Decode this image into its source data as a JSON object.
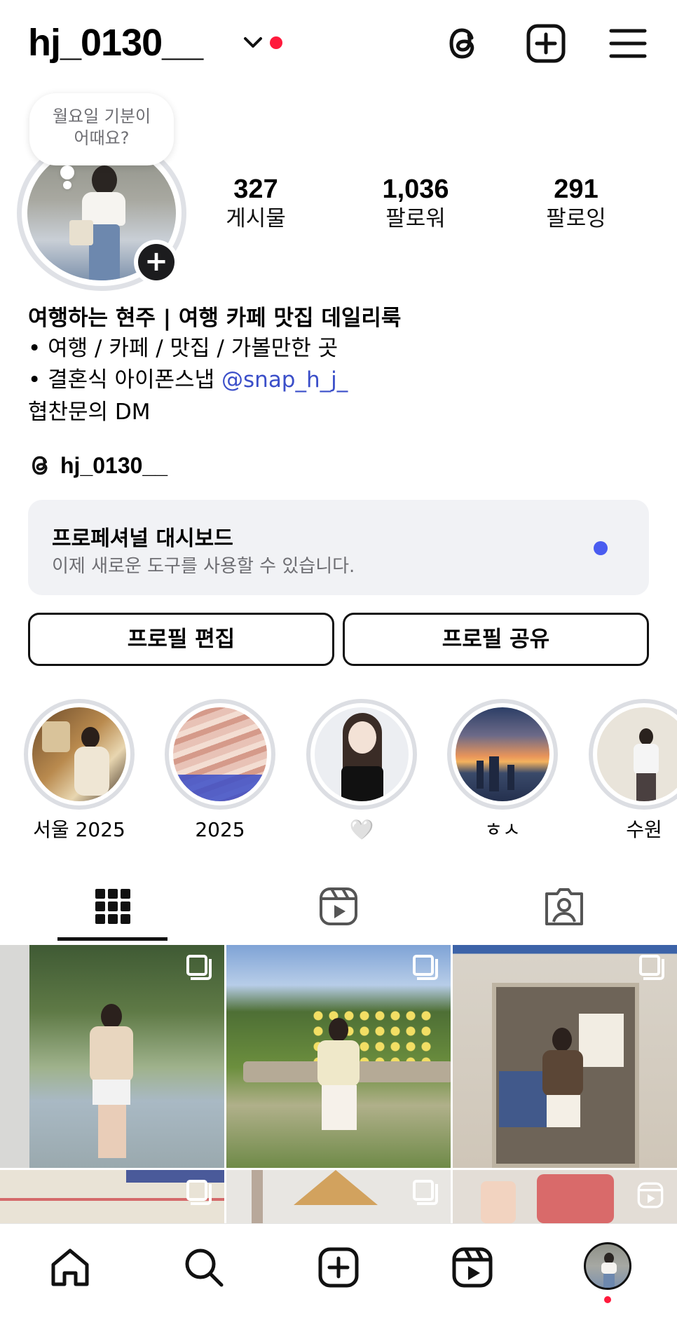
{
  "header": {
    "username": "hj_0130__",
    "has_notification_dot": true
  },
  "profile": {
    "note_bubble": "월요일 기분이\n어때요?",
    "stats": [
      {
        "value": "327",
        "label": "게시물"
      },
      {
        "value": "1,036",
        "label": "팔로워"
      },
      {
        "value": "291",
        "label": "팔로잉"
      }
    ]
  },
  "bio": {
    "name": "여행하는 현주 | 여행 카페 맛집 데일리룩",
    "line1": "• 여행 / 카페 / 맛집 / 가볼만한 곳",
    "line2_prefix": "• 결혼식 아이폰스냅 ",
    "line2_mention": "@snap_h_j_",
    "line3": "협찬문의 DM",
    "threads_handle": "hj_0130__"
  },
  "dashboard": {
    "title": "프로페셔널 대시보드",
    "subtitle": "이제 새로운 도구를 사용할 수 있습니다."
  },
  "buttons": {
    "edit_profile": "프로필 편집",
    "share_profile": "프로필 공유"
  },
  "highlights": [
    {
      "label": "서울 2025"
    },
    {
      "label": "2025"
    },
    {
      "label": "🤍"
    },
    {
      "label": "ㅎㅅ"
    },
    {
      "label": "수원"
    }
  ],
  "tabs": {
    "active": "grid",
    "items": [
      "grid-tab",
      "reels-tab",
      "tagged-tab"
    ]
  },
  "grid": {
    "posts": [
      {
        "type": "carousel"
      },
      {
        "type": "carousel"
      },
      {
        "type": "carousel"
      },
      {
        "type": "carousel"
      },
      {
        "type": "carousel"
      },
      {
        "type": "reel"
      }
    ]
  },
  "colors": {
    "notification": "#ff1a3c",
    "mention": "#3b4fc9",
    "dashboard_dot": "#4a5cf0"
  }
}
